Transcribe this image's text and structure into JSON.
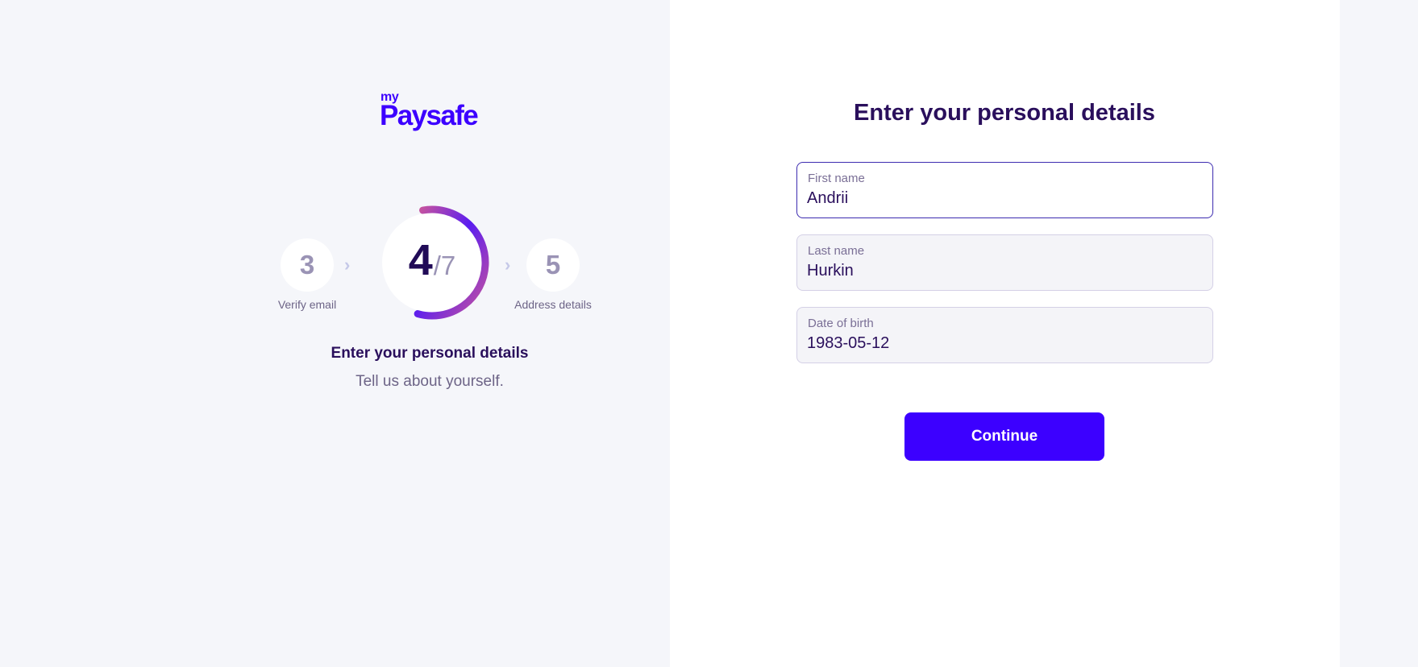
{
  "brand": {
    "prefix": "my",
    "name": "Paysafe",
    "color": "#3c00ff"
  },
  "steps": {
    "previous": {
      "number": "3",
      "label": "Verify email"
    },
    "current": {
      "number": "4",
      "total": "/7",
      "title": "Enter your personal details",
      "subtitle": "Tell us about yourself."
    },
    "next": {
      "number": "5",
      "label": "Address details"
    },
    "progress_fraction": 0.5714
  },
  "form": {
    "title": "Enter your personal details",
    "fields": [
      {
        "label": "First name",
        "value": "Andrii",
        "state": "focused"
      },
      {
        "label": "Last name",
        "value": "Hurkin",
        "state": "default"
      },
      {
        "label": "Date of birth",
        "value": "1983-05-12",
        "state": "default"
      }
    ],
    "continue_label": "Continue"
  },
  "icons": {
    "chevron": "chevron-right-icon"
  }
}
